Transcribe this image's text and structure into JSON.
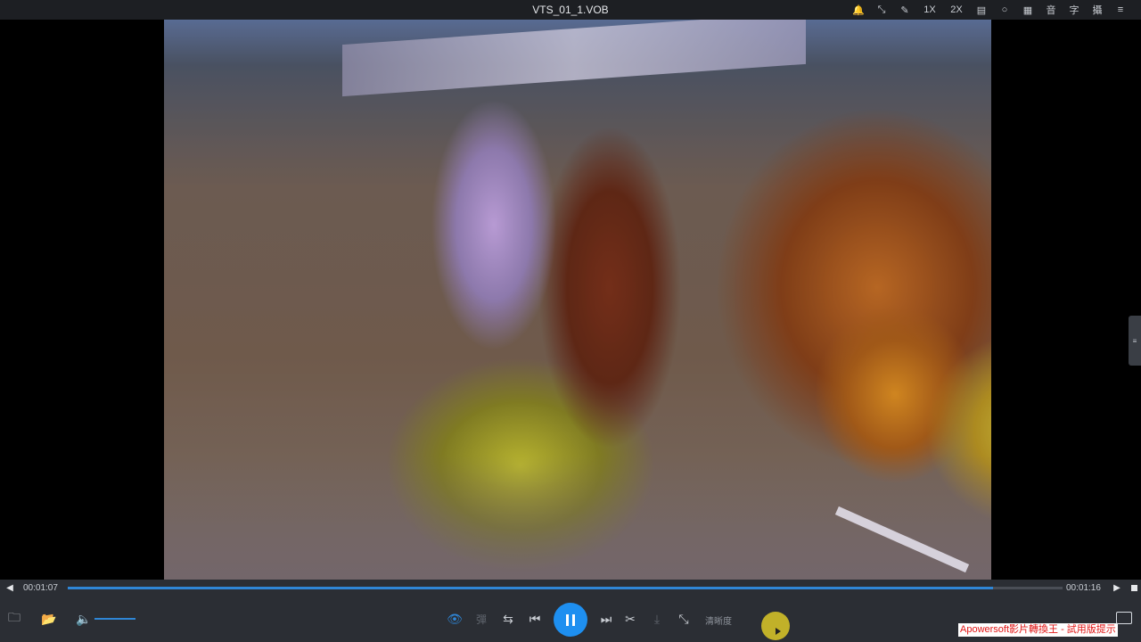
{
  "window": {
    "title": "VTS_01_1.VOB"
  },
  "titlebar_icons": [
    {
      "name": "pin-icon",
      "glyph": "🔔"
    },
    {
      "name": "minimize-mode-icon",
      "glyph": "⤡"
    },
    {
      "name": "edit-icon",
      "glyph": "✎"
    },
    {
      "name": "speed-1x",
      "glyph": "1X"
    },
    {
      "name": "speed-2x",
      "glyph": "2X"
    },
    {
      "name": "layout-icon",
      "glyph": "▤"
    },
    {
      "name": "bulb-icon",
      "glyph": "○"
    },
    {
      "name": "image-icon",
      "glyph": "▦"
    },
    {
      "name": "audio-icon",
      "glyph": "音"
    },
    {
      "name": "subtitle-icon",
      "glyph": "字"
    },
    {
      "name": "capture-icon",
      "glyph": "攝"
    },
    {
      "name": "menu-icon",
      "glyph": "≡"
    }
  ],
  "side_tab": {
    "label": "≡"
  },
  "playback": {
    "current_time": "00:01:07",
    "total_time": "00:01:16",
    "progress": 0.93
  },
  "controls": {
    "prev_frame_glyph": "◀",
    "next_frame_glyph": "▶",
    "open_file_glyph": "🗀",
    "open_folder_glyph": "📂",
    "volume_glyph": "🔈",
    "eye_glyph": "👁",
    "danmaku_label": "彈",
    "adjust_glyph": "⇆",
    "prev_track_glyph": "⏮",
    "next_track_glyph": "⏭",
    "cut_glyph": "✂",
    "download_glyph": "⤓",
    "shrink_glyph": "⤡",
    "quality_label": "清晰度"
  },
  "watermark": {
    "text": "Apowersoft影片轉換王 - 試用版提示"
  },
  "colors": {
    "accent": "#1e8ff0",
    "panel": "#2b2e34",
    "titlebar": "#1d1f23"
  }
}
